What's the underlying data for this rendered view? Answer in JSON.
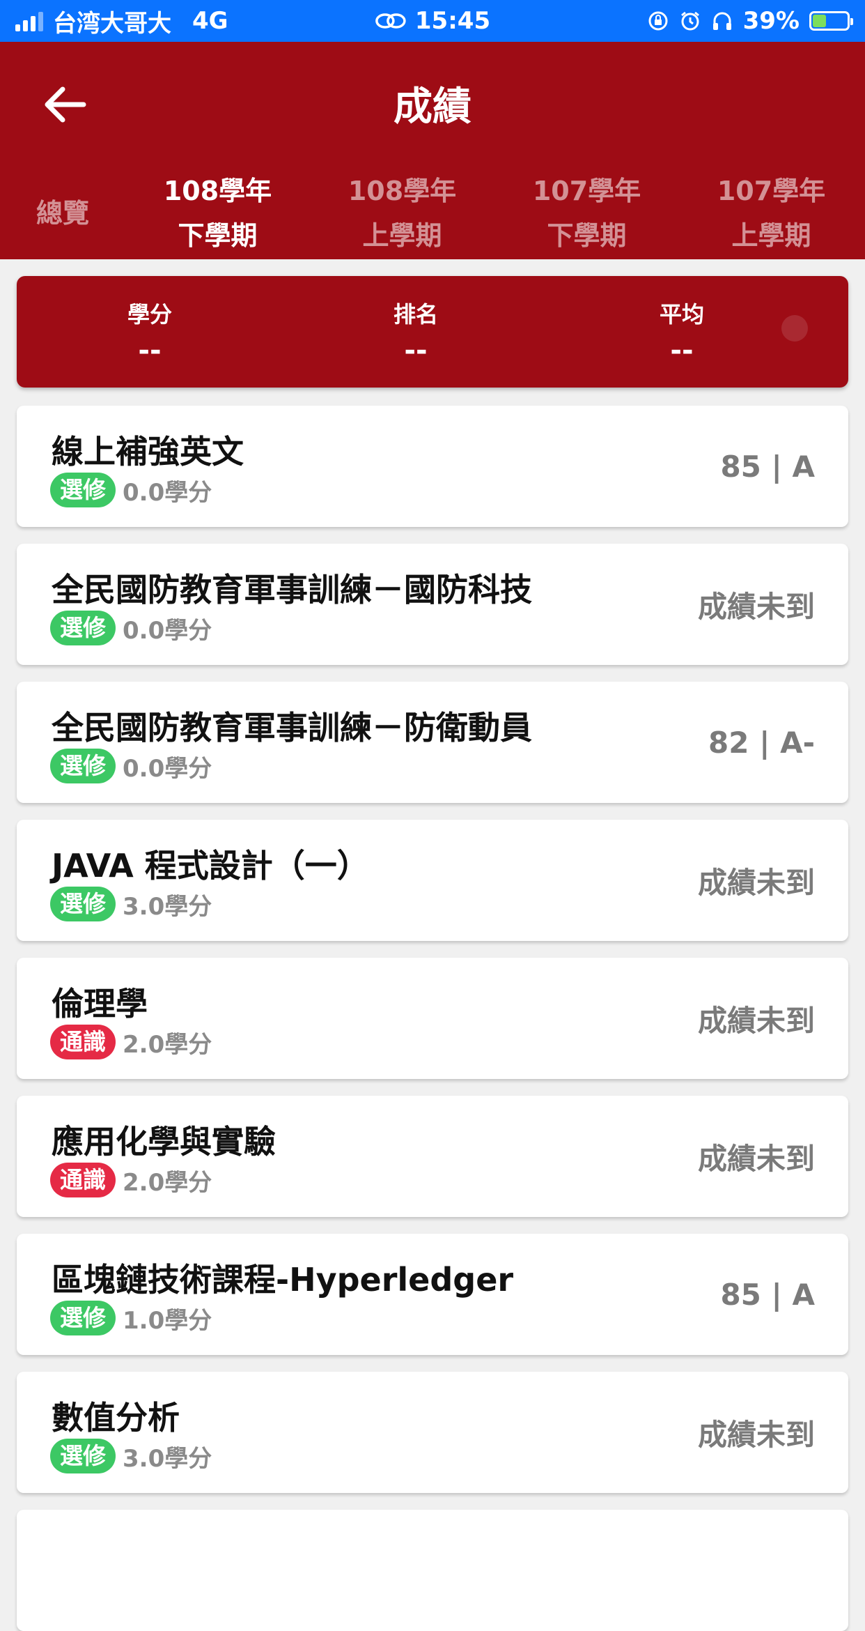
{
  "status_bar": {
    "carrier": "台湾大哥大",
    "network": "4G",
    "time": "15:45",
    "battery": "39%",
    "battery_level": 0.39
  },
  "header": {
    "title": "成績"
  },
  "tabs": [
    {
      "line1": "總覽",
      "line2": ""
    },
    {
      "line1": "108學年",
      "line2": "下學期"
    },
    {
      "line1": "108學年",
      "line2": "上學期"
    },
    {
      "line1": "107學年",
      "line2": "下學期"
    },
    {
      "line1": "107學年",
      "line2": "上學期"
    }
  ],
  "summary": {
    "credits_label": "學分",
    "credits_value": "--",
    "rank_label": "排名",
    "rank_value": "--",
    "average_label": "平均",
    "average_value": "--"
  },
  "courses": [
    {
      "name": "線上補強英文",
      "type": "選修",
      "credits": "0.0學分",
      "grade": "85 | A"
    },
    {
      "name": "全民國防教育軍事訓練－國防科技",
      "type": "選修",
      "credits": "0.0學分",
      "grade": "成績未到"
    },
    {
      "name": "全民國防教育軍事訓練－防衛動員",
      "type": "選修",
      "credits": "0.0學分",
      "grade": "82 | A-"
    },
    {
      "name": "JAVA 程式設計（一）",
      "type": "選修",
      "credits": "3.0學分",
      "grade": "成績未到"
    },
    {
      "name": "倫理學",
      "type": "通識",
      "credits": "2.0學分",
      "grade": "成績未到"
    },
    {
      "name": "應用化學與實驗",
      "type": "通識",
      "credits": "2.0學分",
      "grade": "成績未到"
    },
    {
      "name": "區塊鏈技術課程-Hyperledger",
      "type": "選修",
      "credits": "1.0學分",
      "grade": "85 | A"
    },
    {
      "name": "數值分析",
      "type": "選修",
      "credits": "3.0學分",
      "grade": "成績未到"
    }
  ],
  "colors": {
    "primary": "#9e0c15",
    "status_bar": "#0b73ff",
    "elective_badge": "#3cc864",
    "general_badge": "#e52a45"
  }
}
